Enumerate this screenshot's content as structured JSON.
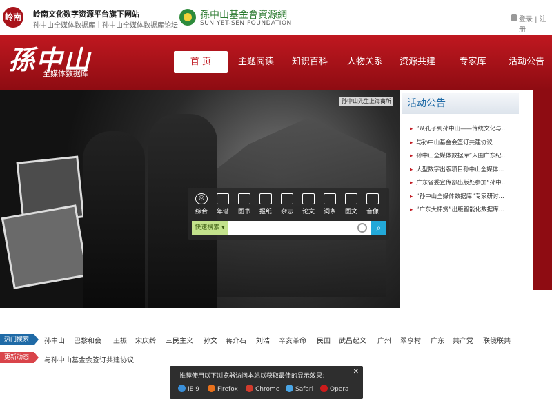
{
  "topbar": {
    "logo_text": "岭南",
    "line1": "岭南文化数字资源平台旗下网站",
    "line2": "孙中山全媒体数据库｜孙中山全媒体数据库论坛",
    "foundation_name": "孫中山基金會資源網",
    "foundation_en": "SUN YET-SEN FOUNDATION",
    "user_links": "登录 | 注册"
  },
  "header": {
    "brand": "孫中山",
    "brand_sub": "全媒体数据库",
    "nav": [
      "首 页",
      "主题阅读",
      "知识百科",
      "人物关系",
      "资源共建",
      "专家库",
      "活动公告"
    ]
  },
  "hero": {
    "caption": "孙中山先生上海寓所"
  },
  "search": {
    "categories": [
      "综合",
      "年谱",
      "图书",
      "报纸",
      "杂志",
      "论文",
      "词条",
      "图文",
      "音像"
    ],
    "quick_label": "快速搜索",
    "placeholder": "",
    "button": "⌕"
  },
  "notice": {
    "title": "活动公告",
    "items": [
      "“从孔子到孙中山——传统文化与...",
      "与孙中山基金会签订共建协议",
      "孙中山全媒体数据库”入围广东纪...",
      "大型数字出版项目孙中山全媒体...",
      "广东省委宣传部出版处参加“孙中...",
      "“孙中山全媒体数据库”专家研讨...",
      "“广东大棒赏”出版智能化数据库..."
    ]
  },
  "hot": {
    "label": "热门搜索",
    "words": [
      "孙中山",
      "巴黎和会",
      "王振",
      "宋庆龄",
      "三民主义",
      "孙文",
      "蒋介石",
      "刘浩",
      "辛亥革命",
      "民国",
      "武昌起义",
      "广州",
      "翠亨村",
      "广东",
      "共产党",
      "联俄联共"
    ]
  },
  "update": {
    "label": "更新动态",
    "text": "与孙中山基金会签订共建协议"
  },
  "browser_notice": {
    "message": "推荐使用以下浏览器访问本站以获取最佳的显示效果：",
    "close": "✕",
    "browsers": [
      {
        "name": "IE 9",
        "color": "#3a8fd8"
      },
      {
        "name": "Firefox",
        "color": "#e8711c"
      },
      {
        "name": "Chrome",
        "color": "#d23b2d"
      },
      {
        "name": "Safari",
        "color": "#4aa6e6"
      },
      {
        "name": "Opera",
        "color": "#cc1b1b"
      }
    ]
  }
}
